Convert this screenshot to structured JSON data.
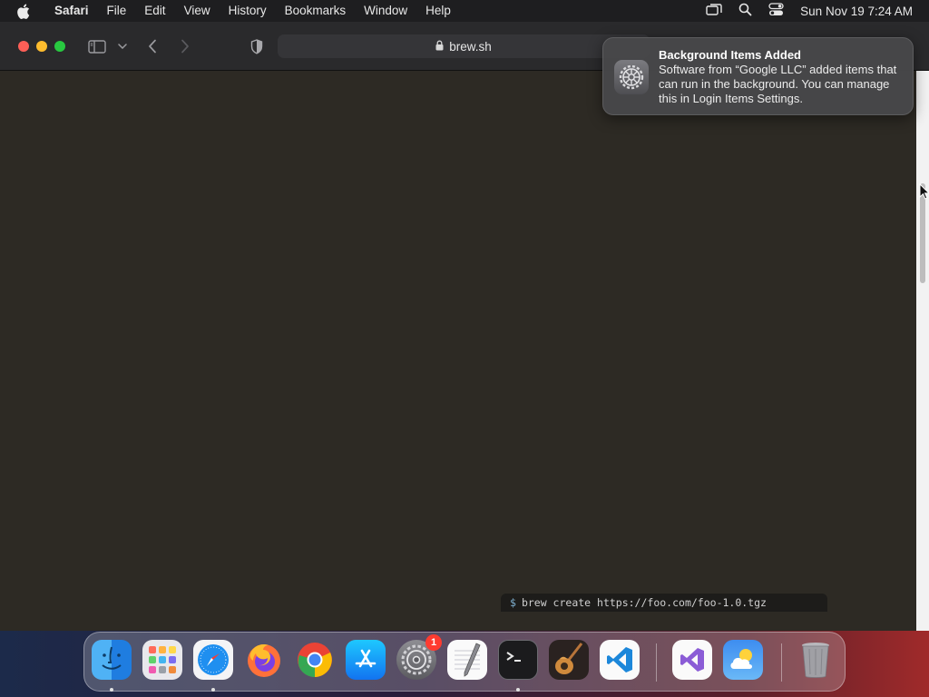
{
  "menubar": {
    "app_name": "Safari",
    "items": [
      "File",
      "Edit",
      "View",
      "History",
      "Bookmarks",
      "Window",
      "Help"
    ],
    "clock": "Sun Nov 19  7:24 AM"
  },
  "browser": {
    "url": "brew.sh"
  },
  "page": {
    "command_prompt": "$",
    "command_text": "brew create https://foo.com/foo-1.0.tgz"
  },
  "notification": {
    "title": "Background Items Added",
    "body": "Software from “Google LLC” added items that can run in the background. You can manage this in Login Items Settings.",
    "icon": "gear-icon"
  },
  "dock": {
    "apps": [
      {
        "name": "Finder",
        "icon": "finder-icon",
        "running": true
      },
      {
        "name": "Launchpad",
        "icon": "launchpad-icon",
        "running": false
      },
      {
        "name": "Safari",
        "icon": "safari-icon",
        "running": true
      },
      {
        "name": "Firefox",
        "icon": "firefox-icon",
        "running": false
      },
      {
        "name": "Google Chrome",
        "icon": "chrome-icon",
        "running": false
      },
      {
        "name": "App Store",
        "icon": "app-store-icon",
        "running": false
      },
      {
        "name": "System Settings",
        "icon": "system-settings-icon",
        "running": false,
        "badge": "1"
      },
      {
        "name": "TextEdit",
        "icon": "textedit-icon",
        "running": false
      },
      {
        "name": "Terminal",
        "icon": "terminal-icon",
        "running": true
      },
      {
        "name": "GarageBand",
        "icon": "garageband-icon",
        "running": false
      },
      {
        "name": "Visual Studio Code",
        "icon": "vscode-icon",
        "running": false
      },
      {
        "name": "Visual Studio",
        "icon": "visual-studio-icon",
        "running": false
      },
      {
        "name": "Weather",
        "icon": "weather-icon",
        "running": false
      },
      {
        "name": "Trash",
        "icon": "trash-icon",
        "running": false
      }
    ]
  },
  "colors": {
    "page_background": "#2d2a24",
    "close": "#fe5f57",
    "minimize": "#febc2e",
    "zoom": "#28c840",
    "badge": "#ff3b30"
  }
}
